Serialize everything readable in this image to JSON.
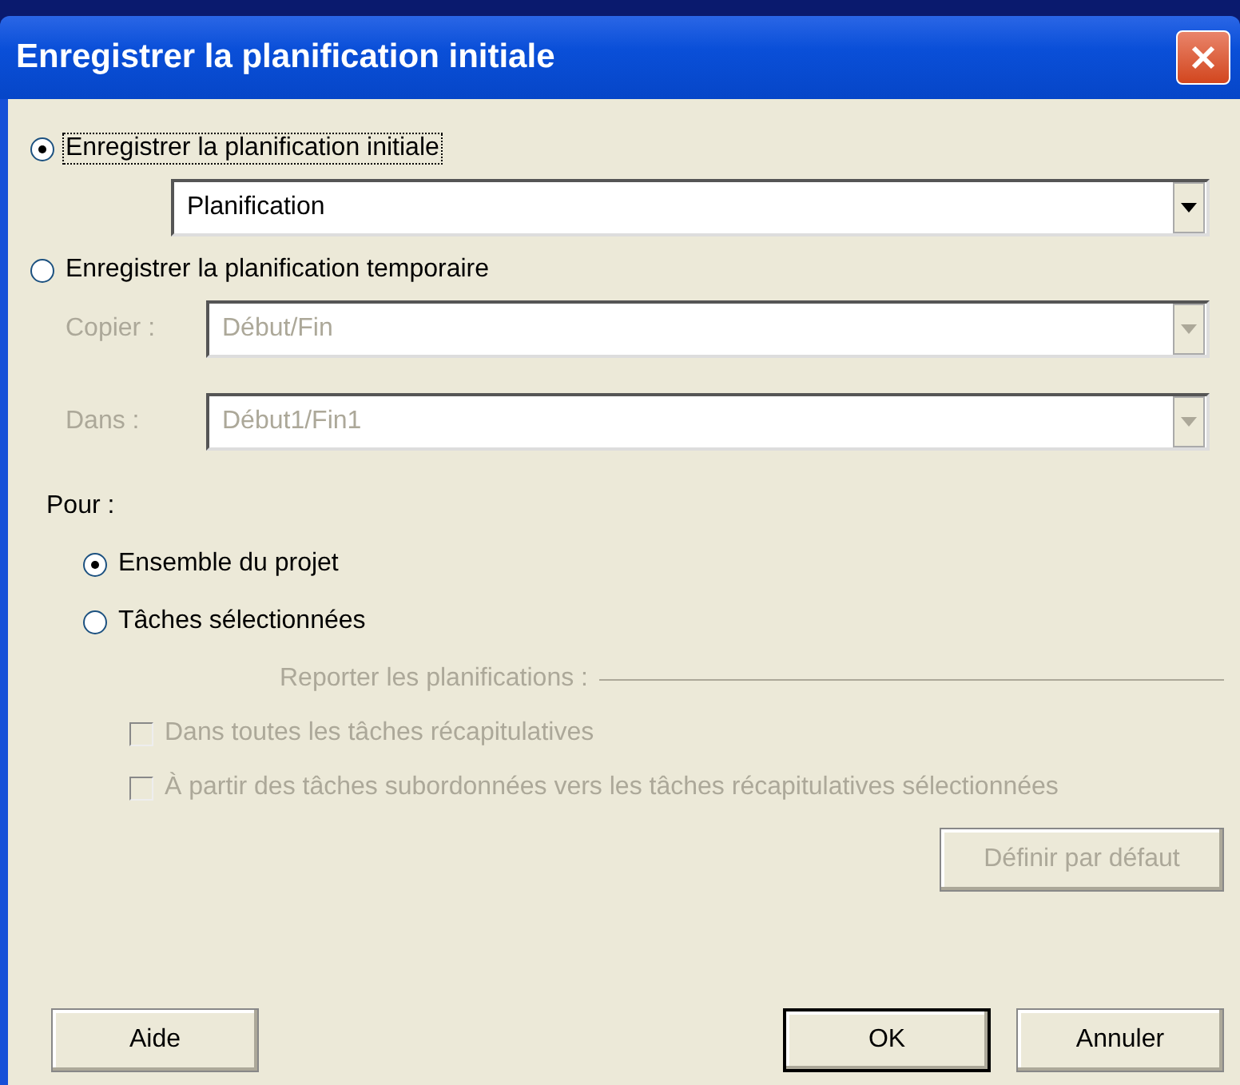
{
  "window": {
    "title": "Enregistrer la planification initiale"
  },
  "save_options": [
    {
      "label": "Enregistrer la planification initiale",
      "selected": true,
      "focused": true,
      "fields": [
        {
          "value": "Planification",
          "disabled": false
        }
      ]
    },
    {
      "label": "Enregistrer la planification temporaire",
      "selected": false,
      "focused": false,
      "fields": [
        {
          "label": "Copier :",
          "value": "Début/Fin",
          "disabled": true
        },
        {
          "label": "Dans :",
          "value": "Début1/Fin1",
          "disabled": true
        }
      ]
    }
  ],
  "scope": {
    "label": "Pour :",
    "options": [
      {
        "label": "Ensemble du projet",
        "selected": true
      },
      {
        "label": "Tâches sélectionnées",
        "selected": false
      }
    ],
    "rollup": {
      "label": "Reporter les planifications :",
      "disabled": true,
      "checkboxes": [
        {
          "label": "Dans toutes les tâches récapitulatives",
          "checked": false,
          "disabled": true
        },
        {
          "label": "À partir des tâches subordonnées vers les tâches récapitulatives sélectionnées",
          "checked": false,
          "disabled": true
        }
      ],
      "default_button": {
        "label": "Définir par défaut",
        "disabled": true
      }
    }
  },
  "buttons": [
    {
      "label": "Aide",
      "default": false
    },
    {
      "label": "OK",
      "default": true
    },
    {
      "label": "Annuler",
      "default": false
    }
  ]
}
